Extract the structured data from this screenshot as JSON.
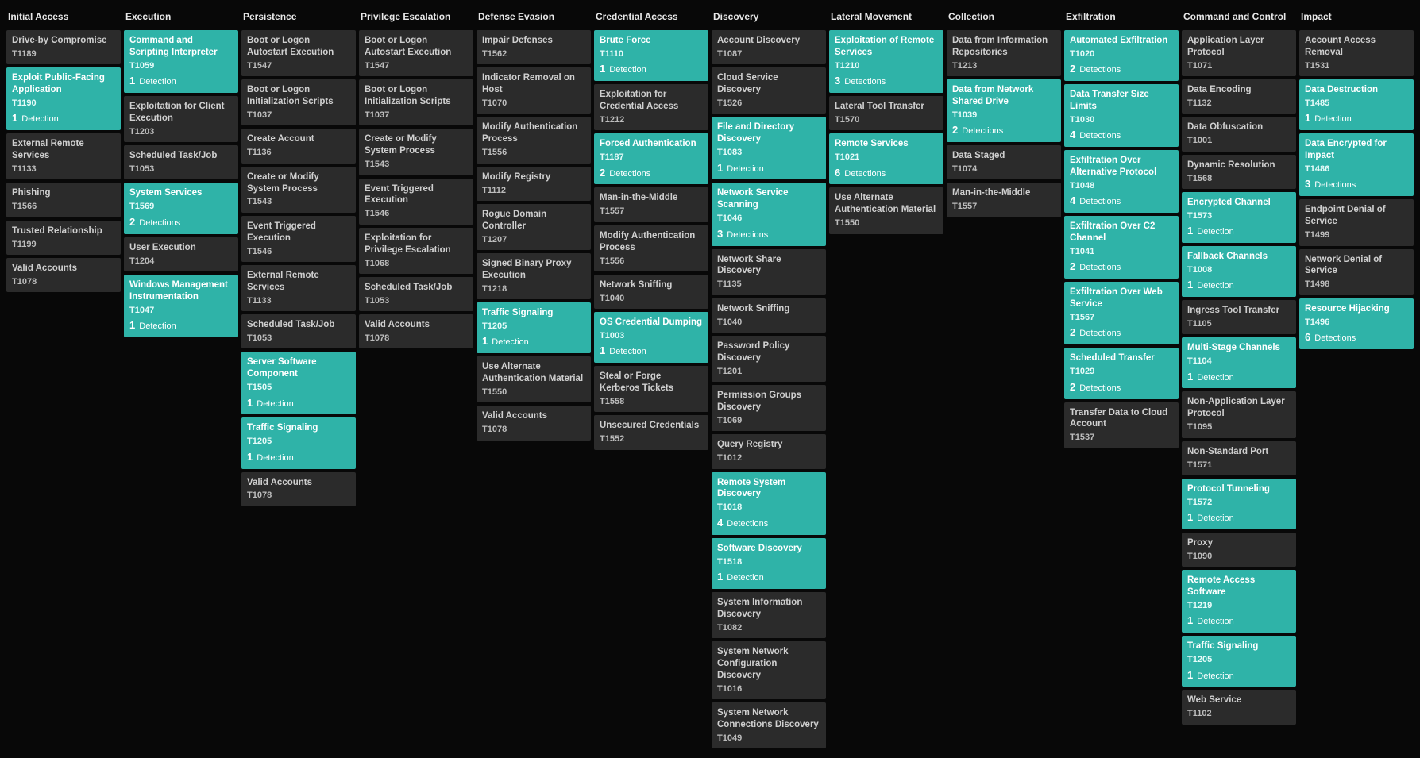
{
  "columns": [
    {
      "title": "Initial Access",
      "items": [
        {
          "name": "Drive-by Compromise",
          "id": "T1189",
          "hl": false
        },
        {
          "name": "Exploit Public-Facing Application",
          "id": "T1190",
          "hl": true,
          "detections": 1
        },
        {
          "name": "External Remote Services",
          "id": "T1133",
          "hl": false
        },
        {
          "name": "Phishing",
          "id": "T1566",
          "hl": false
        },
        {
          "name": "Trusted Relationship",
          "id": "T1199",
          "hl": false
        },
        {
          "name": "Valid Accounts",
          "id": "T1078",
          "hl": false
        }
      ]
    },
    {
      "title": "Execution",
      "items": [
        {
          "name": "Command and Scripting Interpreter",
          "id": "T1059",
          "hl": true,
          "detections": 1
        },
        {
          "name": "Exploitation for Client Execution",
          "id": "T1203",
          "hl": false
        },
        {
          "name": "Scheduled Task/Job",
          "id": "T1053",
          "hl": false
        },
        {
          "name": "System Services",
          "id": "T1569",
          "hl": true,
          "detections": 2
        },
        {
          "name": "User Execution",
          "id": "T1204",
          "hl": false
        },
        {
          "name": "Windows Management Instrumentation",
          "id": "T1047",
          "hl": true,
          "detections": 1
        }
      ]
    },
    {
      "title": "Persistence",
      "items": [
        {
          "name": "Boot or Logon Autostart Execution",
          "id": "T1547",
          "hl": false
        },
        {
          "name": "Boot or Logon Initialization Scripts",
          "id": "T1037",
          "hl": false
        },
        {
          "name": "Create Account",
          "id": "T1136",
          "hl": false
        },
        {
          "name": "Create or Modify System Process",
          "id": "T1543",
          "hl": false
        },
        {
          "name": "Event Triggered Execution",
          "id": "T1546",
          "hl": false
        },
        {
          "name": "External Remote Services",
          "id": "T1133",
          "hl": false
        },
        {
          "name": "Scheduled Task/Job",
          "id": "T1053",
          "hl": false
        },
        {
          "name": "Server Software Component",
          "id": "T1505",
          "hl": true,
          "detections": 1
        },
        {
          "name": "Traffic Signaling",
          "id": "T1205",
          "hl": true,
          "detections": 1
        },
        {
          "name": "Valid Accounts",
          "id": "T1078",
          "hl": false
        }
      ]
    },
    {
      "title": "Privilege Escalation",
      "items": [
        {
          "name": "Boot or Logon Autostart Execution",
          "id": "T1547",
          "hl": false
        },
        {
          "name": "Boot or Logon Initialization Scripts",
          "id": "T1037",
          "hl": false
        },
        {
          "name": "Create or Modify System Process",
          "id": "T1543",
          "hl": false
        },
        {
          "name": "Event Triggered Execution",
          "id": "T1546",
          "hl": false
        },
        {
          "name": "Exploitation for Privilege Escalation",
          "id": "T1068",
          "hl": false
        },
        {
          "name": "Scheduled Task/Job",
          "id": "T1053",
          "hl": false
        },
        {
          "name": "Valid Accounts",
          "id": "T1078",
          "hl": false
        }
      ]
    },
    {
      "title": "Defense Evasion",
      "items": [
        {
          "name": "Impair Defenses",
          "id": "T1562",
          "hl": false
        },
        {
          "name": "Indicator Removal on Host",
          "id": "T1070",
          "hl": false
        },
        {
          "name": "Modify Authentication Process",
          "id": "T1556",
          "hl": false
        },
        {
          "name": "Modify Registry",
          "id": "T1112",
          "hl": false
        },
        {
          "name": "Rogue Domain Controller",
          "id": "T1207",
          "hl": false
        },
        {
          "name": "Signed Binary Proxy Execution",
          "id": "T1218",
          "hl": false
        },
        {
          "name": "Traffic Signaling",
          "id": "T1205",
          "hl": true,
          "detections": 1
        },
        {
          "name": "Use Alternate Authentication Material",
          "id": "T1550",
          "hl": false
        },
        {
          "name": "Valid Accounts",
          "id": "T1078",
          "hl": false
        }
      ]
    },
    {
      "title": "Credential Access",
      "items": [
        {
          "name": "Brute Force",
          "id": "T1110",
          "hl": true,
          "detections": 1
        },
        {
          "name": "Exploitation for Credential Access",
          "id": "T1212",
          "hl": false
        },
        {
          "name": "Forced Authentication",
          "id": "T1187",
          "hl": true,
          "detections": 2
        },
        {
          "name": "Man-in-the-Middle",
          "id": "T1557",
          "hl": false
        },
        {
          "name": "Modify Authentication Process",
          "id": "T1556",
          "hl": false
        },
        {
          "name": "Network Sniffing",
          "id": "T1040",
          "hl": false
        },
        {
          "name": "OS Credential Dumping",
          "id": "T1003",
          "hl": true,
          "detections": 1
        },
        {
          "name": "Steal or Forge Kerberos Tickets",
          "id": "T1558",
          "hl": false
        },
        {
          "name": "Unsecured Credentials",
          "id": "T1552",
          "hl": false
        }
      ]
    },
    {
      "title": "Discovery",
      "items": [
        {
          "name": "Account Discovery",
          "id": "T1087",
          "hl": false
        },
        {
          "name": "Cloud Service Discovery",
          "id": "T1526",
          "hl": false
        },
        {
          "name": "File and Directory Discovery",
          "id": "T1083",
          "hl": true,
          "detections": 1
        },
        {
          "name": "Network Service Scanning",
          "id": "T1046",
          "hl": true,
          "detections": 3
        },
        {
          "name": "Network Share Discovery",
          "id": "T1135",
          "hl": false
        },
        {
          "name": "Network Sniffing",
          "id": "T1040",
          "hl": false
        },
        {
          "name": "Password Policy Discovery",
          "id": "T1201",
          "hl": false
        },
        {
          "name": "Permission Groups Discovery",
          "id": "T1069",
          "hl": false
        },
        {
          "name": "Query Registry",
          "id": "T1012",
          "hl": false
        },
        {
          "name": "Remote System Discovery",
          "id": "T1018",
          "hl": true,
          "detections": 4
        },
        {
          "name": "Software Discovery",
          "id": "T1518",
          "hl": true,
          "detections": 1
        },
        {
          "name": "System Information Discovery",
          "id": "T1082",
          "hl": false
        },
        {
          "name": "System Network Configuration Discovery",
          "id": "T1016",
          "hl": false
        },
        {
          "name": "System Network Connections Discovery",
          "id": "T1049",
          "hl": false
        }
      ]
    },
    {
      "title": "Lateral Movement",
      "items": [
        {
          "name": "Exploitation of Remote Services",
          "id": "T1210",
          "hl": true,
          "detections": 3
        },
        {
          "name": "Lateral Tool Transfer",
          "id": "T1570",
          "hl": false
        },
        {
          "name": "Remote Services",
          "id": "T1021",
          "hl": true,
          "detections": 6
        },
        {
          "name": "Use Alternate Authentication Material",
          "id": "T1550",
          "hl": false
        }
      ]
    },
    {
      "title": "Collection",
      "items": [
        {
          "name": "Data from Information Repositories",
          "id": "T1213",
          "hl": false
        },
        {
          "name": "Data from Network Shared Drive",
          "id": "T1039",
          "hl": true,
          "detections": 2
        },
        {
          "name": "Data Staged",
          "id": "T1074",
          "hl": false
        },
        {
          "name": "Man-in-the-Middle",
          "id": "T1557",
          "hl": false
        }
      ]
    },
    {
      "title": "Exfiltration",
      "items": [
        {
          "name": "Automated Exfiltration",
          "id": "T1020",
          "hl": true,
          "detections": 2
        },
        {
          "name": "Data Transfer Size Limits",
          "id": "T1030",
          "hl": true,
          "detections": 4
        },
        {
          "name": "Exfiltration Over Alternative Protocol",
          "id": "T1048",
          "hl": true,
          "detections": 4
        },
        {
          "name": "Exfiltration Over C2 Channel",
          "id": "T1041",
          "hl": true,
          "detections": 2
        },
        {
          "name": "Exfiltration Over Web Service",
          "id": "T1567",
          "hl": true,
          "detections": 2
        },
        {
          "name": "Scheduled Transfer",
          "id": "T1029",
          "hl": true,
          "detections": 2
        },
        {
          "name": "Transfer Data to Cloud Account",
          "id": "T1537",
          "hl": false
        }
      ]
    },
    {
      "title": "Command and Control",
      "items": [
        {
          "name": "Application Layer Protocol",
          "id": "T1071",
          "hl": false
        },
        {
          "name": "Data Encoding",
          "id": "T1132",
          "hl": false
        },
        {
          "name": "Data Obfuscation",
          "id": "T1001",
          "hl": false
        },
        {
          "name": "Dynamic Resolution",
          "id": "T1568",
          "hl": false
        },
        {
          "name": "Encrypted Channel",
          "id": "T1573",
          "hl": true,
          "detections": 1
        },
        {
          "name": "Fallback Channels",
          "id": "T1008",
          "hl": true,
          "detections": 1
        },
        {
          "name": "Ingress Tool Transfer",
          "id": "T1105",
          "hl": false
        },
        {
          "name": "Multi-Stage Channels",
          "id": "T1104",
          "hl": true,
          "detections": 1
        },
        {
          "name": "Non-Application Layer Protocol",
          "id": "T1095",
          "hl": false
        },
        {
          "name": "Non-Standard Port",
          "id": "T1571",
          "hl": false
        },
        {
          "name": "Protocol Tunneling",
          "id": "T1572",
          "hl": true,
          "detections": 1
        },
        {
          "name": "Proxy",
          "id": "T1090",
          "hl": false
        },
        {
          "name": "Remote Access Software",
          "id": "T1219",
          "hl": true,
          "detections": 1
        },
        {
          "name": "Traffic Signaling",
          "id": "T1205",
          "hl": true,
          "detections": 1
        },
        {
          "name": "Web Service",
          "id": "T1102",
          "hl": false
        }
      ]
    },
    {
      "title": "Impact",
      "items": [
        {
          "name": "Account Access Removal",
          "id": "T1531",
          "hl": false
        },
        {
          "name": "Data Destruction",
          "id": "T1485",
          "hl": true,
          "detections": 1
        },
        {
          "name": "Data Encrypted for Impact",
          "id": "T1486",
          "hl": true,
          "detections": 3
        },
        {
          "name": "Endpoint Denial of Service",
          "id": "T1499",
          "hl": false
        },
        {
          "name": "Network Denial of Service",
          "id": "T1498",
          "hl": false
        },
        {
          "name": "Resource Hijacking",
          "id": "T1496",
          "hl": true,
          "detections": 6
        }
      ]
    }
  ],
  "detection_word_singular": "Detection",
  "detection_word_plural": "Detections"
}
